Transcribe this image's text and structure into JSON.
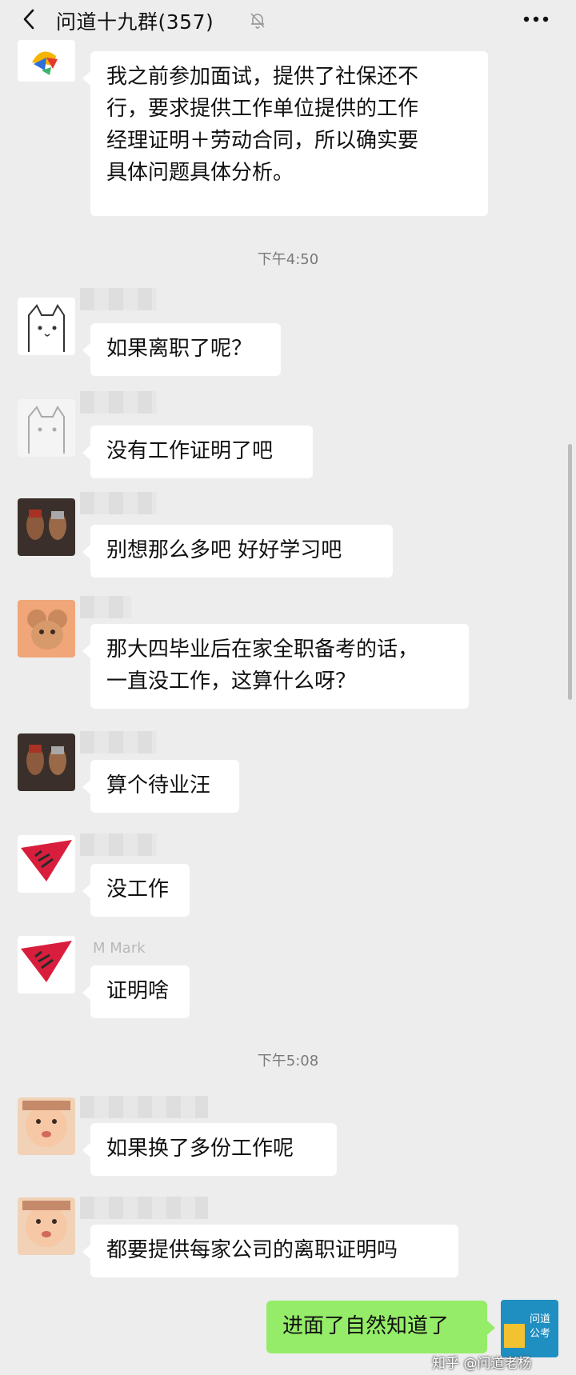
{
  "header": {
    "title": "问道十九群(357)"
  },
  "messages": [
    {
      "text": "我之前参加面试，提供了社保还不\n行，要求提供工作单位提供的工作\n经理证明＋劳动合同，所以确实要\n具体问题具体分析。"
    },
    {
      "text": "如果离职了呢？"
    },
    {
      "text": "没有工作证明了吧"
    },
    {
      "text": "别想那么多吧 好好学习吧"
    },
    {
      "text": "那大四毕业后在家全职备考的话，\n一直没工作，这算什么呀？"
    },
    {
      "text": "算个待业汪"
    },
    {
      "text": "没工作"
    },
    {
      "text": "证明啥"
    },
    {
      "text": "如果换了多份工作呢"
    },
    {
      "text": "都要提供每家公司的离职证明吗"
    },
    {
      "text": "进面了自然知道了"
    }
  ],
  "times": [
    "下午4:50",
    "下午5:08"
  ],
  "nick_visible": "M Mark",
  "self_avatar_text": "问道\n公考",
  "watermark": "知乎 @问道老杨",
  "colors": {
    "background": "#ededed",
    "bubble_other": "#ffffff",
    "bubble_self": "#95ec69"
  }
}
